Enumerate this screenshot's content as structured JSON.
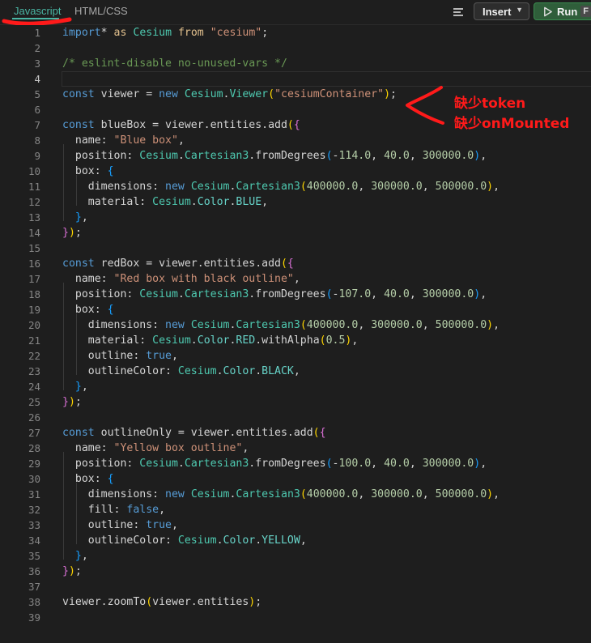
{
  "tabs": [
    {
      "label": "Javascript",
      "active": true
    },
    {
      "label": "HTML/CSS",
      "active": false
    }
  ],
  "toolbar": {
    "menu_icon": "list-icon",
    "insert_label": "Insert",
    "run_label": "Run",
    "run_shortcut": "F"
  },
  "editor": {
    "active_line": 4,
    "lines": [
      [
        [
          "k",
          "import"
        ],
        [
          "",
          "* "
        ],
        [
          "kw",
          "as"
        ],
        [
          "",
          " "
        ],
        [
          "c",
          "Cesium"
        ],
        [
          "",
          " "
        ],
        [
          "kw",
          "from"
        ],
        [
          "",
          " "
        ],
        [
          "s",
          "\"cesium\""
        ],
        [
          "",
          ";"
        ]
      ],
      [],
      [
        [
          "cm",
          "/* eslint-disable no-unused-vars */"
        ]
      ],
      [],
      [
        [
          "k",
          "const"
        ],
        [
          "",
          " viewer = "
        ],
        [
          "k",
          "new"
        ],
        [
          "",
          " "
        ],
        [
          "c",
          "Cesium"
        ],
        [
          "",
          "."
        ],
        [
          "c",
          "Viewer"
        ],
        [
          "p1",
          "("
        ],
        [
          "s",
          "\"cesiumContainer\""
        ],
        [
          "p1",
          ")"
        ],
        [
          "",
          ";"
        ]
      ],
      [],
      [
        [
          "k",
          "const"
        ],
        [
          "",
          " blueBox = viewer.entities.add"
        ],
        [
          "p1",
          "("
        ],
        [
          "p2",
          "{"
        ]
      ],
      [
        [
          "",
          "  name: "
        ],
        [
          "s",
          "\"Blue box\""
        ],
        [
          "",
          ","
        ]
      ],
      [
        [
          "",
          "  position: "
        ],
        [
          "c",
          "Cesium"
        ],
        [
          "",
          "."
        ],
        [
          "c",
          "Cartesian3"
        ],
        [
          "",
          ".fromDegrees"
        ],
        [
          "p3",
          "("
        ],
        [
          "",
          "-"
        ],
        [
          "n",
          "114.0"
        ],
        [
          "",
          ", "
        ],
        [
          "n",
          "40.0"
        ],
        [
          "",
          ", "
        ],
        [
          "n",
          "300000.0"
        ],
        [
          "p3",
          ")"
        ],
        [
          "",
          ","
        ]
      ],
      [
        [
          "",
          "  box: "
        ],
        [
          "p3",
          "{"
        ]
      ],
      [
        [
          "",
          "    dimensions: "
        ],
        [
          "k",
          "new"
        ],
        [
          "",
          " "
        ],
        [
          "c",
          "Cesium"
        ],
        [
          "",
          "."
        ],
        [
          "c",
          "Cartesian3"
        ],
        [
          "p1",
          "("
        ],
        [
          "n",
          "400000.0"
        ],
        [
          "",
          ", "
        ],
        [
          "n",
          "300000.0"
        ],
        [
          "",
          ", "
        ],
        [
          "n",
          "500000.0"
        ],
        [
          "p1",
          ")"
        ],
        [
          "",
          ","
        ]
      ],
      [
        [
          "",
          "    material: "
        ],
        [
          "c",
          "Cesium"
        ],
        [
          "",
          "."
        ],
        [
          "m",
          "Color"
        ],
        [
          "",
          "."
        ],
        [
          "m",
          "BLUE"
        ],
        [
          "",
          ","
        ]
      ],
      [
        [
          "",
          "  "
        ],
        [
          "p3",
          "}"
        ],
        [
          "",
          ","
        ]
      ],
      [
        [
          "p2",
          "}"
        ],
        [
          "p1",
          ")"
        ],
        [
          "",
          ";"
        ]
      ],
      [],
      [
        [
          "k",
          "const"
        ],
        [
          "",
          " redBox = viewer.entities.add"
        ],
        [
          "p1",
          "("
        ],
        [
          "p2",
          "{"
        ]
      ],
      [
        [
          "",
          "  name: "
        ],
        [
          "s",
          "\"Red box with black outline\""
        ],
        [
          "",
          ","
        ]
      ],
      [
        [
          "",
          "  position: "
        ],
        [
          "c",
          "Cesium"
        ],
        [
          "",
          "."
        ],
        [
          "c",
          "Cartesian3"
        ],
        [
          "",
          ".fromDegrees"
        ],
        [
          "p3",
          "("
        ],
        [
          "",
          "-"
        ],
        [
          "n",
          "107.0"
        ],
        [
          "",
          ", "
        ],
        [
          "n",
          "40.0"
        ],
        [
          "",
          ", "
        ],
        [
          "n",
          "300000.0"
        ],
        [
          "p3",
          ")"
        ],
        [
          "",
          ","
        ]
      ],
      [
        [
          "",
          "  box: "
        ],
        [
          "p3",
          "{"
        ]
      ],
      [
        [
          "",
          "    dimensions: "
        ],
        [
          "k",
          "new"
        ],
        [
          "",
          " "
        ],
        [
          "c",
          "Cesium"
        ],
        [
          "",
          "."
        ],
        [
          "c",
          "Cartesian3"
        ],
        [
          "p1",
          "("
        ],
        [
          "n",
          "400000.0"
        ],
        [
          "",
          ", "
        ],
        [
          "n",
          "300000.0"
        ],
        [
          "",
          ", "
        ],
        [
          "n",
          "500000.0"
        ],
        [
          "p1",
          ")"
        ],
        [
          "",
          ","
        ]
      ],
      [
        [
          "",
          "    material: "
        ],
        [
          "c",
          "Cesium"
        ],
        [
          "",
          "."
        ],
        [
          "m",
          "Color"
        ],
        [
          "",
          "."
        ],
        [
          "m",
          "RED"
        ],
        [
          "",
          ".withAlpha"
        ],
        [
          "p1",
          "("
        ],
        [
          "n",
          "0.5"
        ],
        [
          "p1",
          ")"
        ],
        [
          "",
          ","
        ]
      ],
      [
        [
          "",
          "    outline: "
        ],
        [
          "k",
          "true"
        ],
        [
          "",
          ","
        ]
      ],
      [
        [
          "",
          "    outlineColor: "
        ],
        [
          "c",
          "Cesium"
        ],
        [
          "",
          "."
        ],
        [
          "m",
          "Color"
        ],
        [
          "",
          "."
        ],
        [
          "m",
          "BLACK"
        ],
        [
          "",
          ","
        ]
      ],
      [
        [
          "",
          "  "
        ],
        [
          "p3",
          "}"
        ],
        [
          "",
          ","
        ]
      ],
      [
        [
          "p2",
          "}"
        ],
        [
          "p1",
          ")"
        ],
        [
          "",
          ";"
        ]
      ],
      [],
      [
        [
          "k",
          "const"
        ],
        [
          "",
          " outlineOnly = viewer.entities.add"
        ],
        [
          "p1",
          "("
        ],
        [
          "p2",
          "{"
        ]
      ],
      [
        [
          "",
          "  name: "
        ],
        [
          "s",
          "\"Yellow box outline\""
        ],
        [
          "",
          ","
        ]
      ],
      [
        [
          "",
          "  position: "
        ],
        [
          "c",
          "Cesium"
        ],
        [
          "",
          "."
        ],
        [
          "c",
          "Cartesian3"
        ],
        [
          "",
          ".fromDegrees"
        ],
        [
          "p3",
          "("
        ],
        [
          "",
          "-"
        ],
        [
          "n",
          "100.0"
        ],
        [
          "",
          ", "
        ],
        [
          "n",
          "40.0"
        ],
        [
          "",
          ", "
        ],
        [
          "n",
          "300000.0"
        ],
        [
          "p3",
          ")"
        ],
        [
          "",
          ","
        ]
      ],
      [
        [
          "",
          "  box: "
        ],
        [
          "p3",
          "{"
        ]
      ],
      [
        [
          "",
          "    dimensions: "
        ],
        [
          "k",
          "new"
        ],
        [
          "",
          " "
        ],
        [
          "c",
          "Cesium"
        ],
        [
          "",
          "."
        ],
        [
          "c",
          "Cartesian3"
        ],
        [
          "p1",
          "("
        ],
        [
          "n",
          "400000.0"
        ],
        [
          "",
          ", "
        ],
        [
          "n",
          "300000.0"
        ],
        [
          "",
          ", "
        ],
        [
          "n",
          "500000.0"
        ],
        [
          "p1",
          ")"
        ],
        [
          "",
          ","
        ]
      ],
      [
        [
          "",
          "    fill: "
        ],
        [
          "k",
          "false"
        ],
        [
          "",
          ","
        ]
      ],
      [
        [
          "",
          "    outline: "
        ],
        [
          "k",
          "true"
        ],
        [
          "",
          ","
        ]
      ],
      [
        [
          "",
          "    outlineColor: "
        ],
        [
          "c",
          "Cesium"
        ],
        [
          "",
          "."
        ],
        [
          "m",
          "Color"
        ],
        [
          "",
          "."
        ],
        [
          "m",
          "YELLOW"
        ],
        [
          "",
          ","
        ]
      ],
      [
        [
          "",
          "  "
        ],
        [
          "p3",
          "}"
        ],
        [
          "",
          ","
        ]
      ],
      [
        [
          "p2",
          "}"
        ],
        [
          "p1",
          ")"
        ],
        [
          "",
          ";"
        ]
      ],
      [],
      [
        [
          "",
          "viewer.zoomTo"
        ],
        [
          "p1",
          "("
        ],
        [
          "",
          "viewer.entities"
        ],
        [
          "p1",
          ")"
        ],
        [
          "",
          ";"
        ]
      ],
      []
    ]
  },
  "annotation": {
    "notes": [
      "缺少token",
      "缺少onMounted"
    ],
    "color": "#ff1a1a"
  }
}
